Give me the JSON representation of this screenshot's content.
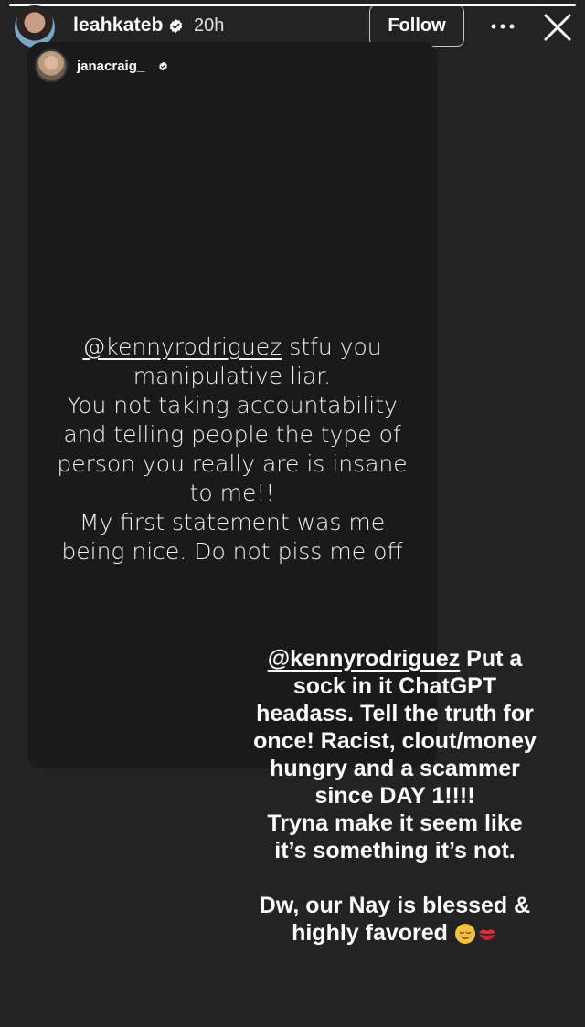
{
  "story": {
    "progress": 1.0
  },
  "header": {
    "username": "leahkateb",
    "time_ago": "20h",
    "follow_label": "Follow",
    "avatar_icon": "avatar",
    "verified_icon": "verified-badge-icon",
    "more_icon": "more-options-icon",
    "close_icon": "close-icon"
  },
  "reshared": {
    "username": "janacraig_",
    "quote": {
      "mention": "@kennyrodriguez",
      "lines": [
        " stfu you",
        "manipulative liar.",
        "You not taking accountability",
        "and telling people the type of",
        "person you really are is insane",
        "to me!!",
        "My first statement was me",
        "being nice. Do not piss me off"
      ]
    }
  },
  "reply": {
    "mention": "@kennyrodriguez",
    "lines": [
      " Put a",
      "sock in it ChatGPT",
      "headass. Tell the truth for",
      "once! Racist, clout/money",
      "hungry and a scammer",
      "since DAY 1!!!!",
      "Tryna make it seem like",
      "it’s something it’s not.",
      "",
      "Dw, our Nay is blessed &",
      "highly favored "
    ],
    "emojis": [
      "relieved-face-emoji",
      "kiss-mark-emoji"
    ]
  }
}
